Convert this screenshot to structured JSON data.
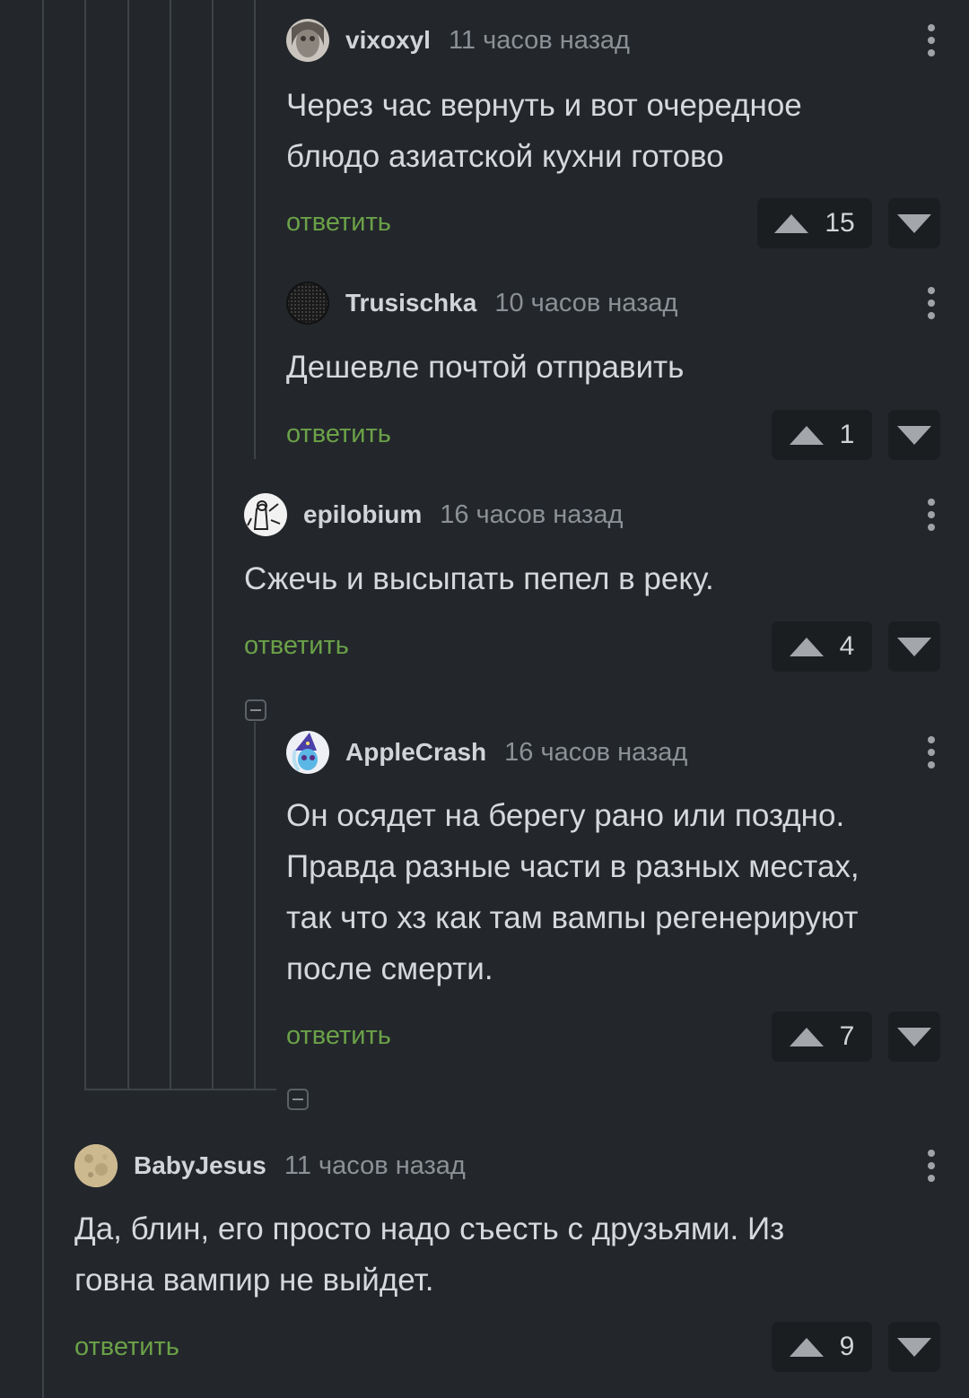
{
  "comments": [
    {
      "user": "vixoxyl",
      "time": "11 часов назад",
      "text": [
        "Через час вернуть и вот очередное",
        "блюдо азиатской кухни готово"
      ],
      "reply": "ответить",
      "votes": "15",
      "avatar": "face-avatar-icon"
    },
    {
      "user": "Trusischka",
      "time": "10 часов назад",
      "text": [
        "Дешевле почтой отправить"
      ],
      "reply": "ответить",
      "votes": "1",
      "avatar": "speaker-grille-avatar-icon"
    },
    {
      "user": "epilobium",
      "time": "16 часов назад",
      "text": [
        "Сжечь и высыпать пепел в реку."
      ],
      "reply": "ответить",
      "votes": "4",
      "avatar": "sketch-avatar-icon"
    },
    {
      "user": "AppleCrash",
      "time": "16 часов назад",
      "text": [
        "Он осядет на берегу рано или поздно.",
        "Правда разные части в разных местах,",
        "так что хз как там вампы регенерируют",
        "после смерти."
      ],
      "reply": "ответить",
      "votes": "7",
      "avatar": "pony-avatar-icon"
    },
    {
      "user": "BabyJesus",
      "time": "11 часов назад",
      "text": [
        "Да, блин, его просто надо съесть с друзьями. Из",
        "говна вампир не выйдет."
      ],
      "reply": "ответить",
      "votes": "9",
      "avatar": "moon-avatar-icon"
    }
  ],
  "colors": {
    "background": "#23272b",
    "reply": "#6ba148",
    "thread_line": "#3e4348",
    "vote_bg": "#1b1e21"
  }
}
